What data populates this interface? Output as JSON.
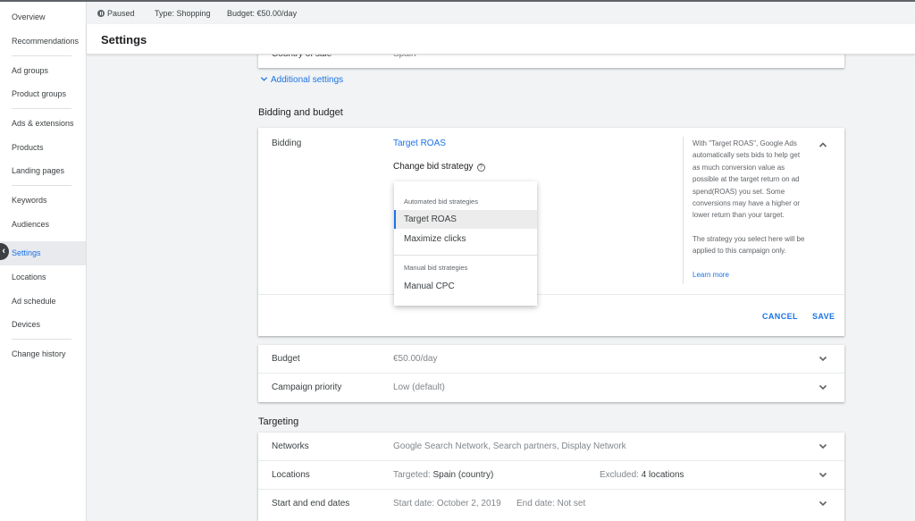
{
  "sidebar": {
    "items": [
      {
        "label": "Overview"
      },
      {
        "label": "Recommendations"
      },
      {
        "label": "Ad groups"
      },
      {
        "label": "Product groups"
      },
      {
        "label": "Ads & extensions"
      },
      {
        "label": "Products"
      },
      {
        "label": "Landing pages"
      },
      {
        "label": "Keywords"
      },
      {
        "label": "Audiences"
      },
      {
        "label": "Settings"
      },
      {
        "label": "Locations"
      },
      {
        "label": "Ad schedule"
      },
      {
        "label": "Devices"
      },
      {
        "label": "Change history"
      }
    ],
    "active": "Settings"
  },
  "header": {
    "status": "Paused",
    "type": "Type: Shopping",
    "budget": "Budget: €50.00/day",
    "title": "Settings"
  },
  "top_card": {
    "country_label": "Country of sale",
    "country_value": "Spain"
  },
  "additional_settings": "Additional settings",
  "bidding_section": {
    "title": "Bidding and budget",
    "bidding_label": "Bidding",
    "strategy": "Target ROAS",
    "change_bid": "Change bid strategy",
    "help_paragraph_1": "With \"Target ROAS\", Google Ads automatically sets bids to help get as much conversion value as possible at the target return on ad spend(ROAS) you set. Some conversions may have a higher or lower return than your target.",
    "help_paragraph_2": "The strategy you select here will be applied to this campaign only.",
    "learn_more": "Learn more",
    "cancel": "CANCEL",
    "save": "SAVE",
    "dropdown": {
      "automated_header": "Automated bid strategies",
      "automated_options": [
        "Target ROAS",
        "Maximize clicks"
      ],
      "manual_header": "Manual bid strategies",
      "manual_options": [
        "Manual CPC"
      ],
      "selected": "Target ROAS"
    }
  },
  "budget_card": {
    "budget_label": "Budget",
    "budget_value": "€50.00/day",
    "priority_label": "Campaign priority",
    "priority_value": "Low (default)"
  },
  "targeting": {
    "title": "Targeting",
    "networks_label": "Networks",
    "networks_value": "Google Search Network, Search partners, Display Network",
    "locations_label": "Locations",
    "locations_targeted_prefix": "Targeted:",
    "locations_targeted": "Spain (country)",
    "locations_excluded_prefix": "Excluded:",
    "locations_excluded": "4 locations",
    "dates_label": "Start and end dates",
    "start_date": "Start date: October 2, 2019",
    "end_date": "End date: Not set"
  },
  "colors": {
    "accent": "#1a73e8",
    "background": "#f1f3f4"
  }
}
